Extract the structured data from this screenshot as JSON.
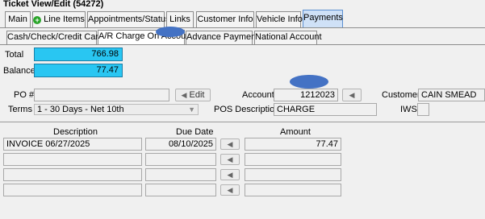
{
  "window": {
    "title": "Ticket View/Edit  (54272)"
  },
  "main_tabs": [
    {
      "label": "Main"
    },
    {
      "label": "Line Items"
    },
    {
      "label": "Appointments/Status"
    },
    {
      "label": "Links"
    },
    {
      "label": "Customer Info"
    },
    {
      "label": "Vehicle Info"
    },
    {
      "label": "Payments"
    }
  ],
  "sub_tabs": [
    {
      "label": "Cash/Check/Credit Card"
    },
    {
      "label": "A/R Charge On Account"
    },
    {
      "label": "Advance Payment"
    },
    {
      "label": "National Account"
    }
  ],
  "totals": {
    "total_label": "Total",
    "total_value": "766.98",
    "balance_label": "Balance",
    "balance_value": "77.47"
  },
  "form": {
    "po_label": "PO #",
    "po_value": "",
    "edit_button": "Edit",
    "account_label": "Account",
    "account_value": "1212023",
    "customer_label": "Customer",
    "customer_value": "CAIN SMEAD",
    "terms_label": "Terms",
    "terms_value": "1 - 30 Days - Net 10th",
    "pos_label": "POS Description",
    "pos_value": "CHARGE",
    "iws_label": "IWS",
    "iws_value": ""
  },
  "invoice_table": {
    "headers": {
      "description": "Description",
      "due_date": "Due Date",
      "amount": "Amount"
    },
    "rows": [
      {
        "description": "INVOICE 06/27/2025",
        "due_date": "08/10/2025",
        "amount": "77.47"
      },
      {
        "description": "",
        "due_date": "",
        "amount": ""
      },
      {
        "description": "",
        "due_date": "",
        "amount": ""
      },
      {
        "description": "",
        "due_date": "",
        "amount": ""
      }
    ]
  },
  "icons": {
    "line_items": "plus-circle-icon",
    "back_arrow": "arrow-left-icon",
    "dropdown": "chevron-down-icon"
  },
  "colors": {
    "highlight": "#29c6f2",
    "annotation": "#4472c4",
    "active_tab": "#cfe1f7"
  }
}
